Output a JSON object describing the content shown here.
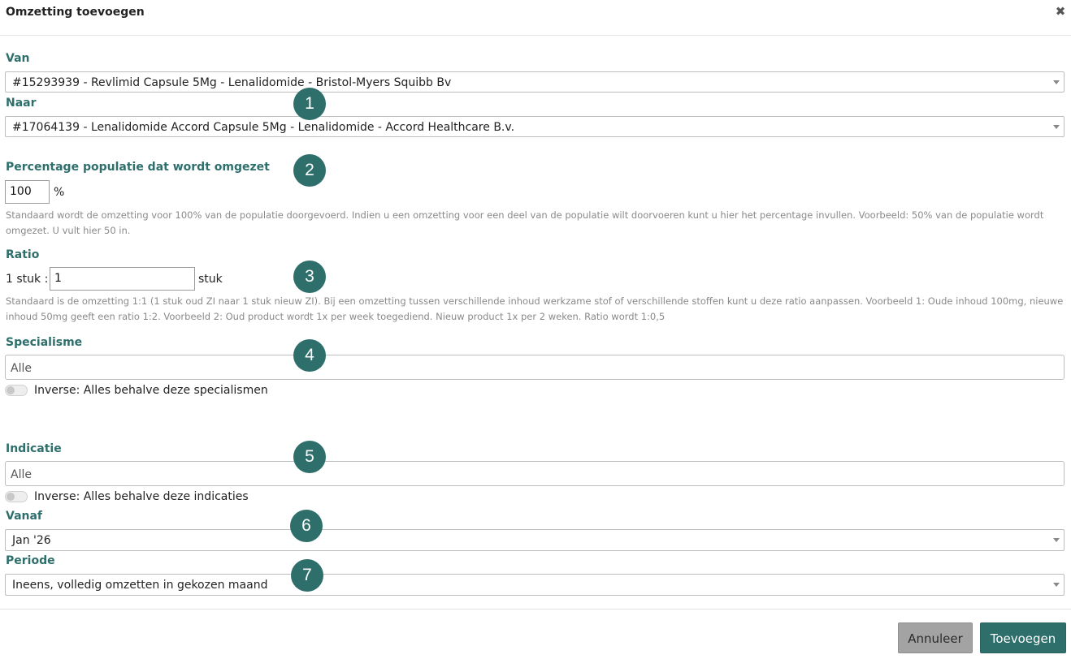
{
  "dialog": {
    "title": "Omzetting toevoegen",
    "close_icon": "close-icon"
  },
  "van": {
    "label": "Van",
    "value": "#15293939 - Revlimid Capsule 5Mg - Lenalidomide - Bristol-Myers Squibb Bv"
  },
  "naar": {
    "label": "Naar",
    "value": "#17064139 - Lenalidomide Accord Capsule 5Mg - Lenalidomide - Accord Healthcare B.v."
  },
  "percentage": {
    "label": "Percentage populatie dat wordt omgezet",
    "value": "100",
    "unit": "%",
    "help": "Standaard wordt de omzetting voor 100% van de populatie doorgevoerd. Indien u een omzetting voor een deel van de populatie wilt doorvoeren kunt u hier het percentage invullen. Voorbeeld: 50% van de populatie wordt omgezet. U vult hier 50 in."
  },
  "ratio": {
    "label": "Ratio",
    "prefix": "1 stuk :",
    "value": "1",
    "unit": "stuk",
    "help": "Standaard is de omzetting 1:1 (1 stuk oud ZI naar 1 stuk nieuw ZI). Bij een omzetting tussen verschillende inhoud werkzame stof of verschillende stoffen kunt u deze ratio aanpassen. Voorbeeld 1: Oude inhoud 100mg, nieuwe inhoud 50mg geeft een ratio 1:2. Voorbeeld 2: Oud product wordt 1x per week toegediend. Nieuw product 1x per 2 weken. Ratio wordt 1:0,5"
  },
  "specialisme": {
    "label": "Specialisme",
    "placeholder": "Alle",
    "inverse_label": "Inverse: Alles behalve deze specialismen",
    "inverse_on": false
  },
  "indicatie": {
    "label": "Indicatie",
    "placeholder": "Alle",
    "inverse_label": "Inverse: Alles behalve deze indicaties",
    "inverse_on": false
  },
  "vanaf": {
    "label": "Vanaf",
    "value": "Jan '26"
  },
  "periode": {
    "label": "Periode",
    "value": "Ineens, volledig omzetten in gekozen maand"
  },
  "badges": [
    "1",
    "2",
    "3",
    "4",
    "5",
    "6",
    "7"
  ],
  "buttons": {
    "cancel": "Annuleer",
    "add": "Toevoegen"
  },
  "colors": {
    "accent": "#2e6f6c",
    "cancel": "#a3a3a3"
  }
}
